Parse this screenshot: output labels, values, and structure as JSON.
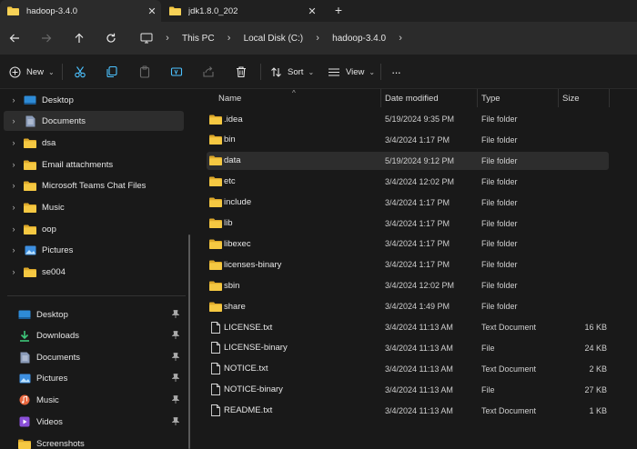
{
  "tabs": [
    {
      "title": "hadoop-3.4.0",
      "active": true
    },
    {
      "title": "jdk1.8.0_202",
      "active": false
    }
  ],
  "tab_close_glyph": "✕",
  "new_tab_glyph": "+",
  "breadcrumb": [
    "This PC",
    "Local Disk (C:)",
    "hadoop-3.4.0"
  ],
  "breadcrumb_sep": "›",
  "toolbar": {
    "new_label": "New",
    "sort_label": "Sort",
    "view_label": "View",
    "more_glyph": "···",
    "chev": "⌄"
  },
  "sidebar": {
    "tree": [
      {
        "label": "Desktop",
        "icon": "desktop-icon",
        "selected": false
      },
      {
        "label": "Documents",
        "icon": "documents-icon",
        "selected": true
      },
      {
        "label": "dsa",
        "icon": "folder-icon",
        "selected": false
      },
      {
        "label": "Email attachments",
        "icon": "folder-icon",
        "selected": false
      },
      {
        "label": "Microsoft Teams Chat Files",
        "icon": "folder-icon",
        "selected": false
      },
      {
        "label": "Music",
        "icon": "folder-icon",
        "selected": false
      },
      {
        "label": "oop",
        "icon": "folder-icon",
        "selected": false
      },
      {
        "label": "Pictures",
        "icon": "pictures-icon",
        "selected": false
      },
      {
        "label": "se004",
        "icon": "folder-icon",
        "selected": false
      }
    ],
    "quick": [
      {
        "label": "Desktop",
        "icon": "desktop-icon"
      },
      {
        "label": "Downloads",
        "icon": "downloads-icon"
      },
      {
        "label": "Documents",
        "icon": "documents-icon"
      },
      {
        "label": "Pictures",
        "icon": "pictures-icon"
      },
      {
        "label": "Music",
        "icon": "music-icon"
      },
      {
        "label": "Videos",
        "icon": "videos-icon"
      },
      {
        "label": "Screenshots",
        "icon": "folder-icon"
      }
    ],
    "chev_glyph": "›",
    "pin_glyph": "📌"
  },
  "columns": {
    "name": "Name",
    "date": "Date modified",
    "type": "Type",
    "size": "Size"
  },
  "sort_caret": "^",
  "files": [
    {
      "name": ".idea",
      "date": "5/19/2024 9:35 PM",
      "type": "File folder",
      "size": "",
      "kind": "folder",
      "selected": false
    },
    {
      "name": "bin",
      "date": "3/4/2024 1:17 PM",
      "type": "File folder",
      "size": "",
      "kind": "folder",
      "selected": false
    },
    {
      "name": "data",
      "date": "5/19/2024 9:12 PM",
      "type": "File folder",
      "size": "",
      "kind": "folder",
      "selected": true
    },
    {
      "name": "etc",
      "date": "3/4/2024 12:02 PM",
      "type": "File folder",
      "size": "",
      "kind": "folder",
      "selected": false
    },
    {
      "name": "include",
      "date": "3/4/2024 1:17 PM",
      "type": "File folder",
      "size": "",
      "kind": "folder",
      "selected": false
    },
    {
      "name": "lib",
      "date": "3/4/2024 1:17 PM",
      "type": "File folder",
      "size": "",
      "kind": "folder",
      "selected": false
    },
    {
      "name": "libexec",
      "date": "3/4/2024 1:17 PM",
      "type": "File folder",
      "size": "",
      "kind": "folder",
      "selected": false
    },
    {
      "name": "licenses-binary",
      "date": "3/4/2024 1:17 PM",
      "type": "File folder",
      "size": "",
      "kind": "folder",
      "selected": false
    },
    {
      "name": "sbin",
      "date": "3/4/2024 12:02 PM",
      "type": "File folder",
      "size": "",
      "kind": "folder",
      "selected": false
    },
    {
      "name": "share",
      "date": "3/4/2024 1:49 PM",
      "type": "File folder",
      "size": "",
      "kind": "folder",
      "selected": false
    },
    {
      "name": "LICENSE.txt",
      "date": "3/4/2024 11:13 AM",
      "type": "Text Document",
      "size": "16 KB",
      "kind": "file",
      "selected": false
    },
    {
      "name": "LICENSE-binary",
      "date": "3/4/2024 11:13 AM",
      "type": "File",
      "size": "24 KB",
      "kind": "file",
      "selected": false
    },
    {
      "name": "NOTICE.txt",
      "date": "3/4/2024 11:13 AM",
      "type": "Text Document",
      "size": "2 KB",
      "kind": "file",
      "selected": false
    },
    {
      "name": "NOTICE-binary",
      "date": "3/4/2024 11:13 AM",
      "type": "File",
      "size": "27 KB",
      "kind": "file",
      "selected": false
    },
    {
      "name": "README.txt",
      "date": "3/4/2024 11:13 AM",
      "type": "Text Document",
      "size": "1 KB",
      "kind": "file",
      "selected": false
    }
  ],
  "colors": {
    "folder": "#f5c842",
    "folder_dark": "#dca82a",
    "accent_blue": "#4cc2ff",
    "selected_bg": "#2d2d2d"
  }
}
